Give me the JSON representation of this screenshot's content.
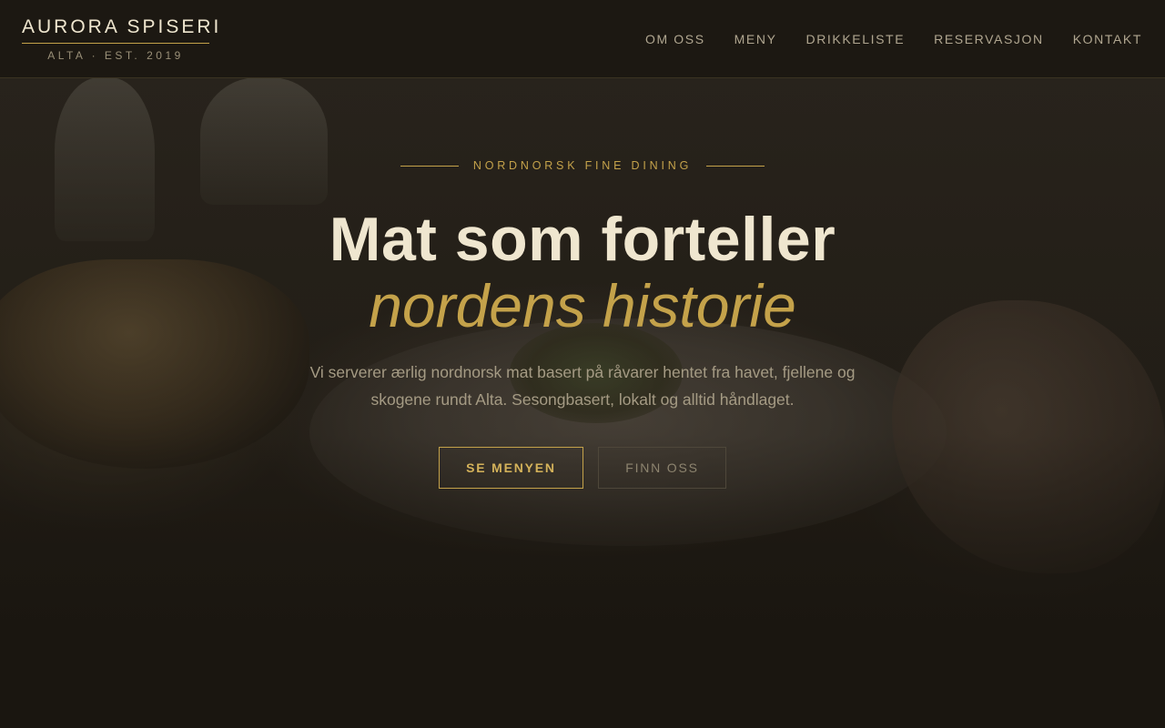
{
  "header": {
    "logo_name": "AURORA SPISERI",
    "logo_sub": "ALTA · EST. 2019",
    "nav": [
      {
        "label": "OM OSS"
      },
      {
        "label": "MENY"
      },
      {
        "label": "DRIKKELISTE"
      },
      {
        "label": "RESERVASJON"
      },
      {
        "label": "KONTAKT"
      }
    ]
  },
  "hero": {
    "eyebrow": "NORDNORSK FINE DINING",
    "headline": "Mat som forteller",
    "headline_accent": "nordens historie",
    "lead": "Vi serverer ærlig nordnorsk mat basert på råvarer hentet fra havet, fjellene og skogene rundt Alta. Sesongbasert, lokalt og alltid håndlaget.",
    "primary_button": "SE MENYEN",
    "secondary_button": "FINN OSS"
  },
  "colors": {
    "accent_gold": "#c4a24a",
    "background": "#1a1610",
    "headline_cream": "#efe6cf"
  }
}
